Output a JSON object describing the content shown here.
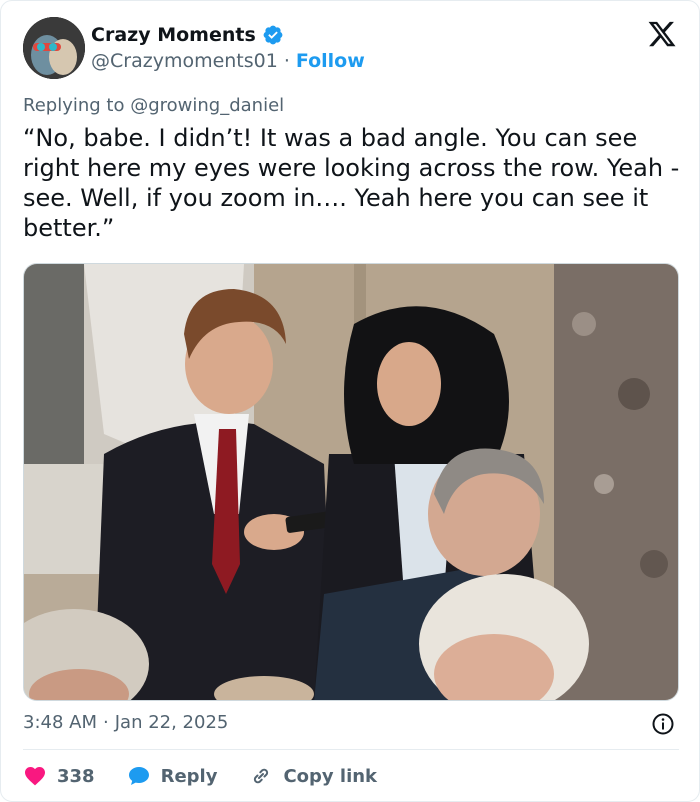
{
  "author": {
    "display_name": "Crazy Moments",
    "handle": "@Crazymoments01",
    "separator": "·",
    "follow_label": "Follow"
  },
  "reply_context": {
    "prefix": "Replying to",
    "mention": "@growing_daniel"
  },
  "tweet": {
    "text": "“No, babe. I didn’t! It was a bad angle. You can see right here my eyes were looking across the row. Yeah - see. Well, if you zoom in…. Yeah here you can see it better.”",
    "time": "3:48 AM",
    "separator": "·",
    "date": "Jan 22, 2025"
  },
  "actions": {
    "likes_count": "338",
    "reply_label": "Reply",
    "copy_link_label": "Copy link"
  },
  "icons": {
    "verified": "verified-badge-icon",
    "platform": "x-logo-icon",
    "info": "info-icon",
    "like": "heart-icon",
    "reply": "speech-bubble-icon",
    "link": "link-icon"
  },
  "colors": {
    "accent": "#1d9bf0",
    "like": "#f91880",
    "text": "#0f1419",
    "muted": "#536471"
  }
}
